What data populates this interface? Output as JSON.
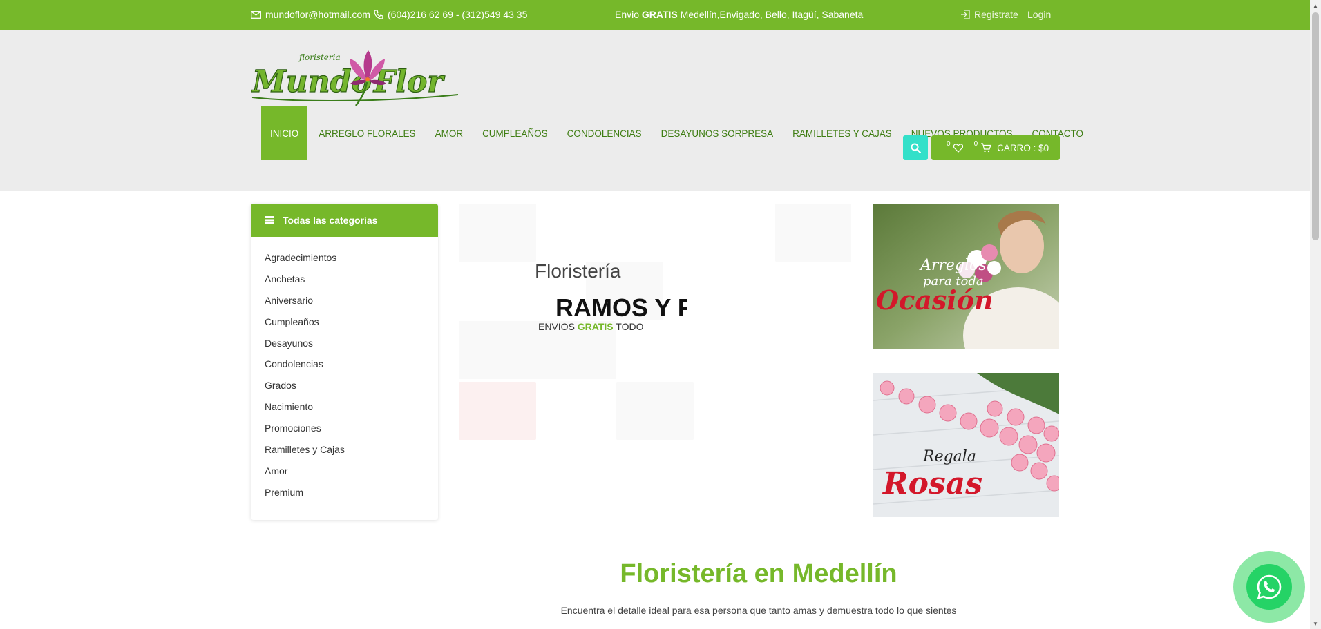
{
  "topbar": {
    "email": "mundoflor@hotmail.com",
    "phone": "(604)216 62 69 - (312)549 43 35",
    "shipping_prefix": "Envio",
    "shipping_bold": "GRATIS",
    "shipping_rest": "Medellín,Envigado, Bello, Itagüí, Sabaneta",
    "register": "Registrate",
    "login": "Login"
  },
  "logo": {
    "top_text": "floristeria",
    "text_1": "Mundo",
    "text_2": "Flor"
  },
  "nav": {
    "items": [
      "INICIO",
      "ARREGLO FLORALES",
      "AMOR",
      "CUMPLEAÑOS",
      "CONDOLENCIAS",
      "DESAYUNOS SORPRESA",
      "RAMILLETES Y CAJAS",
      "NUEVOS PRODUCTOS",
      "CONTACTO"
    ],
    "active": "INICIO"
  },
  "cart": {
    "wish_count": "0",
    "cart_count": "0",
    "label": "CARRO : $0"
  },
  "categories": {
    "title": "Todas las categorías",
    "items": [
      "Agradecimientos",
      "Anchetas",
      "Aniversario",
      "Cumpleaños",
      "Desayunos",
      "Condolencias",
      "Grados",
      "Nacimiento",
      "Promociones",
      "Ramilletes y Cajas",
      "Amor",
      "Premium"
    ]
  },
  "slider": {
    "kicker": "Floristería",
    "title": "RAMOS Y FLORES",
    "sub_prefix": "ENVIOS",
    "sub_green": "GRATIS",
    "sub_rest": "TODO"
  },
  "banners": {
    "b1_line1": "Arreglos",
    "b1_line2": "para toda",
    "b1_line3": "Ocasión",
    "b2_line1": "Regala",
    "b2_line2": "Rosas"
  },
  "intro": {
    "title": "Floristería en Medellín",
    "text": "Encuentra el detalle ideal para esa persona que tanto amas y demuestra todo lo que sientes"
  },
  "colors": {
    "brand_green": "#76b82a",
    "search_teal": "#33e0c9",
    "whatsapp": "#25d366",
    "header_bg": "#ececec"
  }
}
